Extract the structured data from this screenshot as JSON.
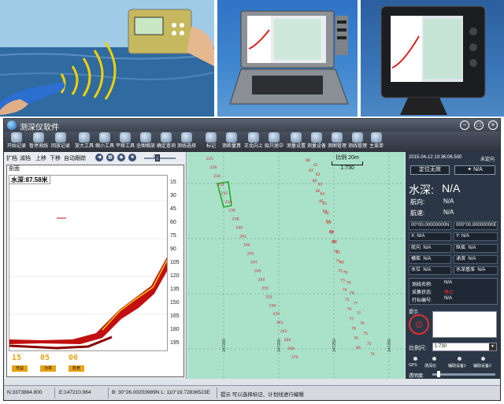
{
  "app": {
    "title": "测深仪软件",
    "window_buttons": [
      "−",
      "□",
      "×"
    ]
  },
  "toolbar": [
    {
      "label": "开始记录",
      "icon": "record-start-icon"
    },
    {
      "label": "暂停测线",
      "icon": "pause-line-icon"
    },
    {
      "label": "回放记录",
      "icon": "replay-icon"
    },
    {
      "label": "放大工具",
      "icon": "zoom-in-icon"
    },
    {
      "label": "缩小工具",
      "icon": "zoom-out-icon"
    },
    {
      "label": "平移工具",
      "icon": "pan-hand-icon"
    },
    {
      "label": "全图缩放",
      "icon": "zoom-all-icon"
    },
    {
      "label": "确定查询",
      "icon": "query-icon"
    },
    {
      "label": "测线选择",
      "icon": "line-select-icon"
    },
    {
      "label": "标记",
      "icon": "marker-icon"
    },
    {
      "label": "测距量算",
      "icon": "measure-icon"
    },
    {
      "label": "正北向上",
      "icon": "north-up-icon"
    },
    {
      "label": "船只居中",
      "icon": "ship-center-icon"
    },
    {
      "label": "测量设置",
      "icon": "survey-settings-icon"
    },
    {
      "label": "测量设备",
      "icon": "survey-device-icon"
    },
    {
      "label": "测图管理",
      "icon": "map-manage-icon"
    },
    {
      "label": "测线管理",
      "icon": "line-manage-icon"
    },
    {
      "label": "主菜单",
      "icon": "main-menu-icon"
    }
  ],
  "left_panel": {
    "controls": [
      "扩档",
      "减档",
      "上移",
      "下移",
      "自动跟踪"
    ],
    "slider_value": "070",
    "tab_label": "剖面",
    "depth_readout": "水深:87.58米",
    "ticks": [
      "15",
      "30",
      "45",
      "60",
      "75",
      "90",
      "105",
      "120",
      "135",
      "150",
      "165",
      "180",
      "195"
    ],
    "bottom_numbers": [
      "15",
      "05",
      "06"
    ],
    "bottom_sub": [
      "增益",
      "功率",
      "脉宽"
    ]
  },
  "map": {
    "scale_label": "比例",
    "scale_value": "20m",
    "scale_sub": "1:730",
    "sounding_line1": [
      "225",
      "228",
      "230",
      "232",
      "231",
      "234",
      "236",
      "238",
      "240",
      "242",
      "244",
      "245",
      "247",
      "249",
      "250",
      "253",
      "255",
      "256",
      "259",
      "261",
      "263",
      "266",
      "268",
      "270"
    ],
    "sounding_line2": [
      "88",
      "87",
      "86",
      "86",
      "85",
      "84",
      "84",
      "83",
      "82",
      "81",
      "80",
      "79",
      "79",
      "78",
      "77",
      "77",
      "76",
      "75",
      "75",
      "74"
    ],
    "sounding_line3": [
      "61",
      "62",
      "63",
      "64",
      "65",
      "66",
      "67",
      "68",
      "69",
      "70",
      "71",
      "72",
      "73",
      "74",
      "75",
      "76",
      "77",
      "78",
      "79",
      "80"
    ],
    "bottom_labels": [
      "147200",
      "147200",
      "147250",
      "147250"
    ]
  },
  "right_panel": {
    "datetime": "2015-04-12 10:36:06.500",
    "positioning_status": "未定向",
    "button_left": "定位无效",
    "button_right": "N/A",
    "depth_label": "水深:",
    "depth_value": "N/A",
    "heading_label": "航向:",
    "heading_value": "N/A",
    "speed_label": "航速:",
    "speed_value": "N/A",
    "coord_left": "00°00.00000000N",
    "coord_right": "000°00.00000000E",
    "x_label": "X:",
    "x_value": "N/A",
    "y_label": "Y:",
    "y_value": "N/A",
    "grid": [
      [
        "航向",
        "N/A",
        "纵摇",
        "N/A"
      ],
      [
        "横摇",
        "N/A",
        "涌浪",
        "N/A"
      ],
      [
        "水位",
        "N/A",
        "水深基准",
        "N/A"
      ]
    ],
    "survey_name_label": "测线名称:",
    "survey_name_value": "N/A",
    "collect_status_label": "采集状态:",
    "collect_status_value": "停止",
    "mark_num_label": "打标编号:",
    "mark_num_value": "N/A",
    "prompt_label": "提示",
    "scale_label": "比例尺:",
    "scale_value": "1:730",
    "device_labels": [
      "GPS",
      "测深仪",
      "辅助设备1",
      "辅助设备2"
    ],
    "transparency_label": "透明度:"
  },
  "statusbar": {
    "north": "N:3373884.800",
    "east": "E:147210.964",
    "latlon": "B: 30°26.00203989N  L: 110°19.72836523E",
    "hint": "提示  可以选择标记、计划线进行编辑"
  },
  "colors": {
    "map_bg": "#a9e2c9",
    "panel_dark": "#2b3746",
    "sounding_red": "#d21f1f",
    "boat_green": "#2aa52a",
    "echo_red": "#c21010"
  }
}
